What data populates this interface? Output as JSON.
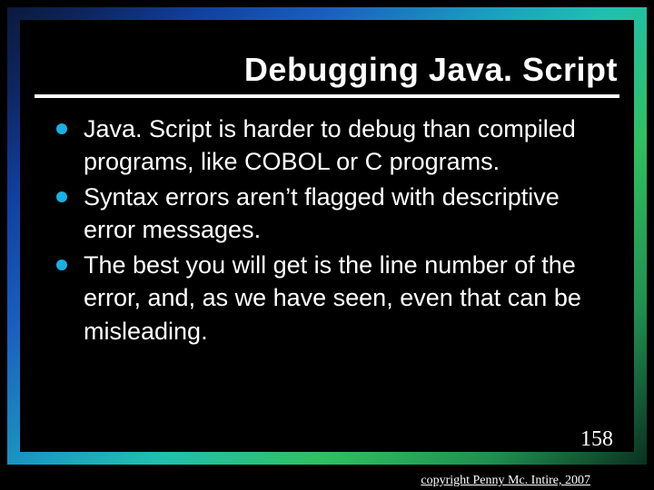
{
  "title": "Debugging Java. Script",
  "bullets": [
    "Java. Script is harder to debug than compiled programs, like COBOL or C programs.",
    "Syntax errors aren’t flagged with descriptive error messages.",
    "The best you will get is the line number of the error, and, as we have seen, even that can be misleading."
  ],
  "page_number": "158",
  "copyright": "copyright Penny Mc. Intire, 2007"
}
